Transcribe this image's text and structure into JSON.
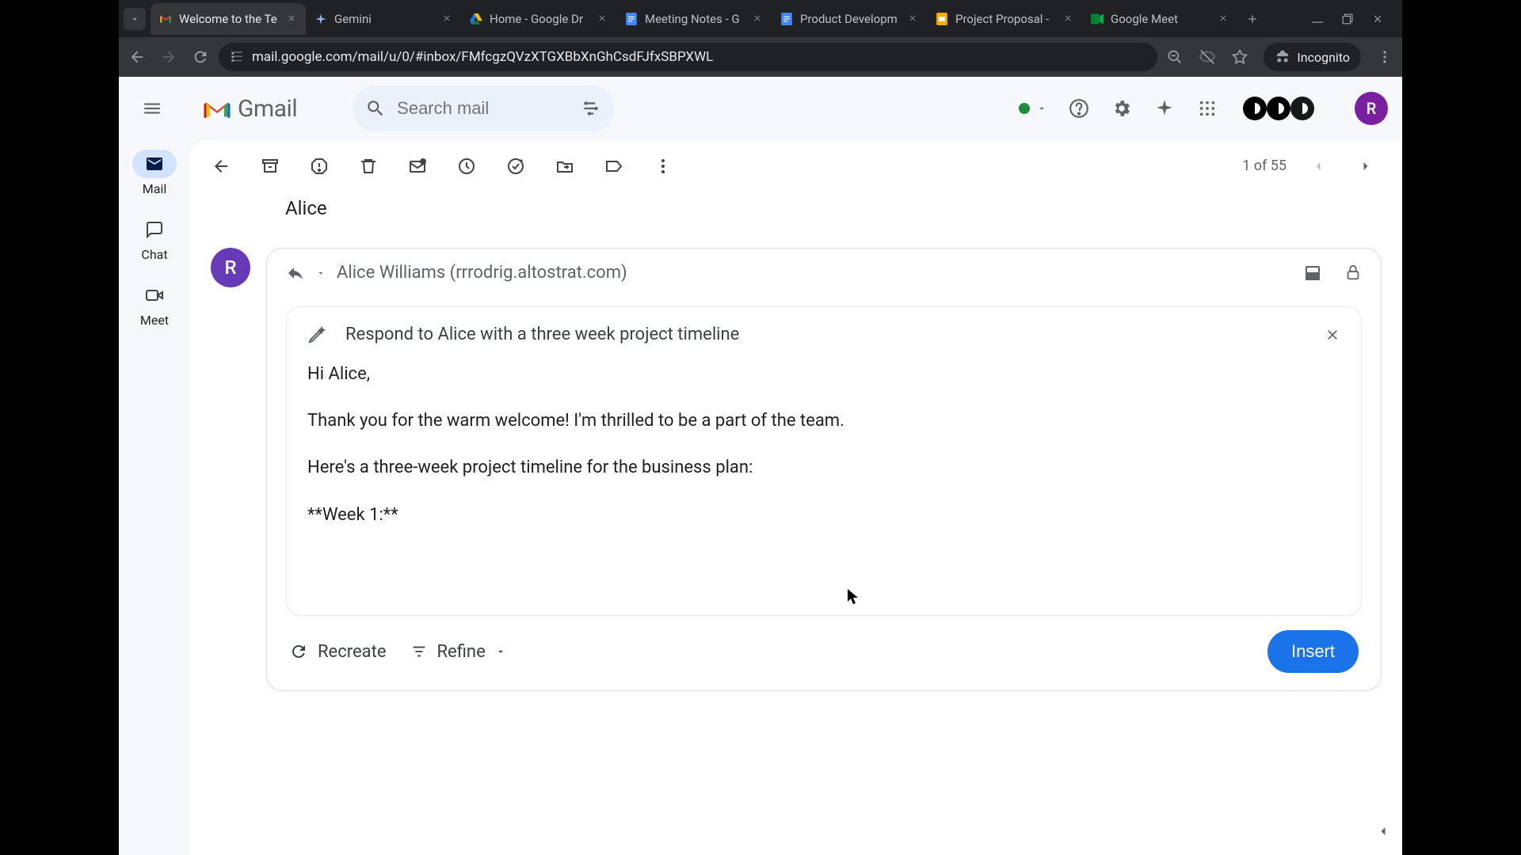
{
  "browser": {
    "tabs": [
      {
        "title": "Welcome to the Te",
        "active": true,
        "favicon": "gmail"
      },
      {
        "title": "Gemini",
        "favicon": "gemini"
      },
      {
        "title": "Home - Google Dr",
        "favicon": "drive"
      },
      {
        "title": "Meeting Notes - G",
        "favicon": "docs"
      },
      {
        "title": "Product Developm",
        "favicon": "docs"
      },
      {
        "title": "Project Proposal -",
        "favicon": "slides"
      },
      {
        "title": "Google Meet",
        "favicon": "meet"
      }
    ],
    "url": "mail.google.com/mail/u/0/#inbox/FMfcgzQVzXTGXBbXnGhCsdFJfxSBPXWL",
    "incognito_label": "Incognito"
  },
  "gmail": {
    "logo_text": "Gmail",
    "search_placeholder": "Search mail",
    "avatar_letter": "R",
    "rail": {
      "mail": "Mail",
      "chat": "Chat",
      "meet": "Meet"
    },
    "pager": "1 of 55",
    "sender_name": "Alice",
    "reply": {
      "avatar_letter": "R",
      "recipient": "Alice Williams (rrrodrig.altostrat.com)",
      "prompt": "Respond to Alice with a three week project timeline",
      "draft": {
        "greeting": "Hi Alice,",
        "para1": "Thank you for the warm welcome! I'm thrilled to be a part of the team.",
        "para2": "Here's a three-week project timeline for the business plan:",
        "para3": "**Week 1:**"
      },
      "recreate_label": "Recreate",
      "refine_label": "Refine",
      "insert_label": "Insert"
    }
  }
}
